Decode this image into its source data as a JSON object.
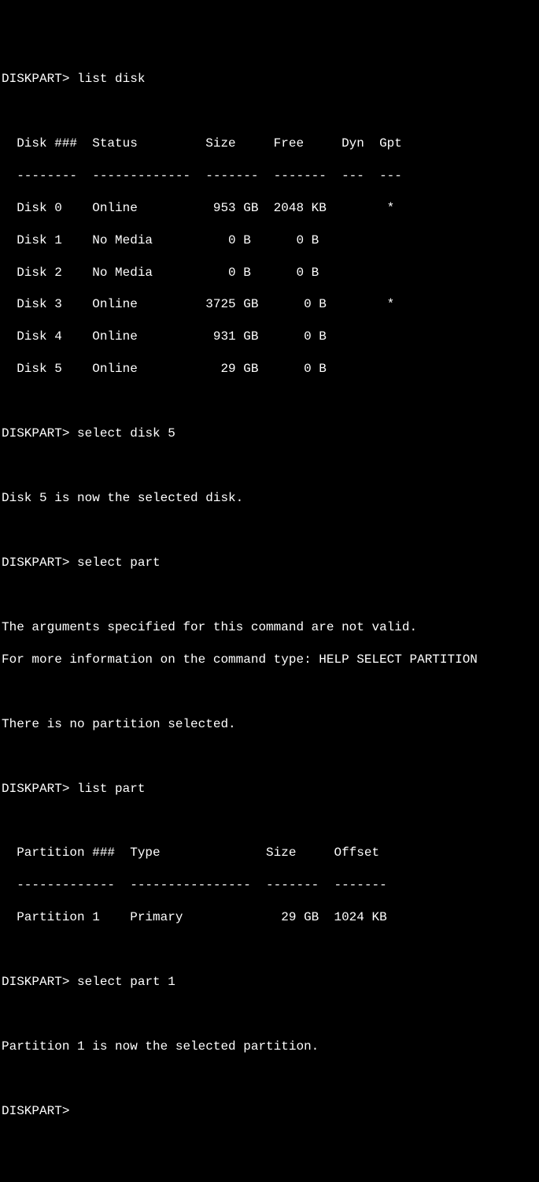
{
  "prompt": "DISKPART>",
  "commands": {
    "list_disk": "list disk",
    "select_disk_5": "select disk 5",
    "select_part": "select part",
    "list_part": "list part",
    "select_part_1": "select part 1"
  },
  "disk_table": {
    "header": "  Disk ###  Status         Size     Free     Dyn  Gpt",
    "separator": "  --------  -------------  -------  -------  ---  ---",
    "rows": [
      "  Disk 0    Online          953 GB  2048 KB        *",
      "  Disk 1    No Media          0 B      0 B",
      "  Disk 2    No Media          0 B      0 B",
      "  Disk 3    Online         3725 GB      0 B        *",
      "  Disk 4    Online          931 GB      0 B",
      "  Disk 5    Online           29 GB      0 B"
    ]
  },
  "messages": {
    "disk_selected": "Disk 5 is now the selected disk.",
    "args_invalid": "The arguments specified for this command are not valid.",
    "more_info": "For more information on the command type: HELP SELECT PARTITION",
    "no_partition": "There is no partition selected.",
    "partition_selected": "Partition 1 is now the selected partition."
  },
  "partition_table": {
    "header": "  Partition ###  Type              Size     Offset",
    "separator": "  -------------  ----------------  -------  -------",
    "rows": [
      "  Partition 1    Primary             29 GB  1024 KB"
    ]
  }
}
